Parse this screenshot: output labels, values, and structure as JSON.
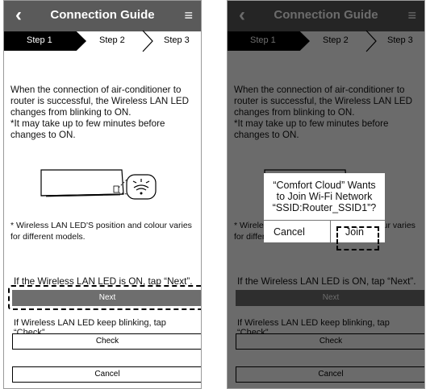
{
  "header": {
    "back_icon": "‹",
    "title": "Connection Guide",
    "menu_icon": "≡"
  },
  "steps": {
    "step1": "Step 1",
    "step2": "Step 2",
    "step3": "Step 3"
  },
  "content": {
    "description_line1": "When the connection of air-conditioner to router is successful, the Wireless LAN LED changes from blinking to ON.",
    "description_line2": "*It may take up to few minutes before changes to ON.",
    "note": "* Wireless LAN LED'S position and colour varies for different models.",
    "if_next_text": "If the Wireless LAN LED is ON, tap “Next”.",
    "next_label": "Next",
    "if_check_text": "If Wireless LAN LED keep blinking, tap “Check”.",
    "check_label": "Check",
    "cancel_label": "Cancel"
  },
  "dialog": {
    "message_line1": "“Comfort Cloud” Wants",
    "message_line2": "to Join Wi-Fi Network",
    "message_line3": "“SSID:Router_SSID1”?",
    "cancel_label": "Cancel",
    "join_label": "Join"
  },
  "colors": {
    "header_bg": "#5a5a5a",
    "step_active_bg": "#000000",
    "next_button_bg": "#6e6e6e",
    "overlay": "rgba(0,0,0,0.58)"
  }
}
